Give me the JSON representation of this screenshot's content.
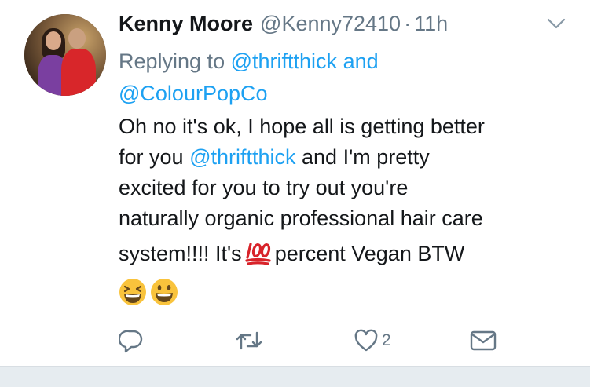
{
  "tweet": {
    "author_name": "Kenny Moore",
    "author_handle": "@Kenny72410",
    "separator": "·",
    "timestamp": "11h",
    "replying_prefix": "Replying to",
    "reply_handle_1": "@thriftthick",
    "replying_and": "and",
    "reply_handle_2": "@ColourPopCo",
    "body": {
      "line1": "Oh no it's ok, I hope all is getting better",
      "line2_before": "for you",
      "line2_mention": "@thriftthick",
      "line2_after": "and I'm pretty",
      "line3": "excited for you to try out you're",
      "line4": "naturally organic professional hair care",
      "line5_before": "system!!!! It's",
      "line5_after": "percent Vegan BTW"
    },
    "emoji_icons": [
      "laughing-face-icon",
      "grinning-face-icon",
      "hundred-points-icon"
    ],
    "actions": {
      "like_count": "2"
    }
  },
  "colors": {
    "link": "#1da1f2",
    "secondary_text": "#657786",
    "primary_text": "#14171a",
    "emoji_yellow": "#f9c33c",
    "hundred_red": "#d8232a"
  }
}
